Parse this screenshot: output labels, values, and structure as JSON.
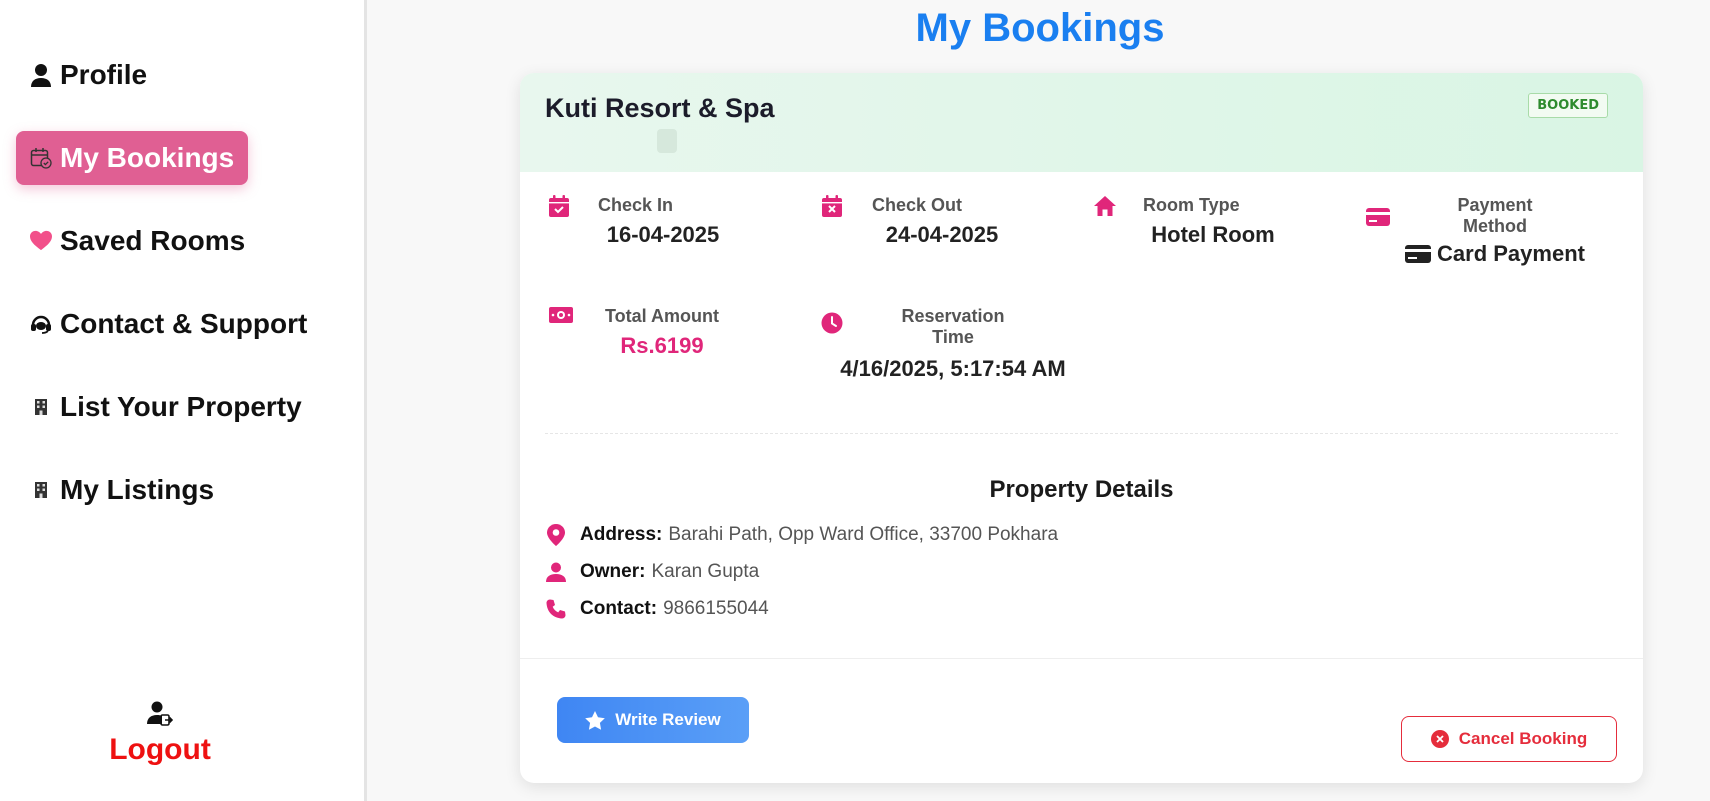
{
  "sidebar": {
    "items": [
      {
        "label": "Profile",
        "icon": "user-icon"
      },
      {
        "label": "My Bookings",
        "icon": "calendar-check-icon"
      },
      {
        "label": "Saved Rooms",
        "icon": "heart-icon"
      },
      {
        "label": "Contact & Support",
        "icon": "headset-icon"
      },
      {
        "label": "List Your Property",
        "icon": "building-icon"
      },
      {
        "label": "My Listings",
        "icon": "building-icon"
      }
    ],
    "logout_label": "Logout"
  },
  "page": {
    "title": "My Bookings"
  },
  "booking": {
    "hotel_name": "Kuti Resort & Spa",
    "status": "BOOKED",
    "check_in": {
      "label": "Check In",
      "value": "16-04-2025"
    },
    "check_out": {
      "label": "Check Out",
      "value": "24-04-2025"
    },
    "room_type": {
      "label": "Room Type",
      "value": "Hotel Room"
    },
    "payment": {
      "label_line1": "Payment",
      "label_line2": "Method",
      "value": "Card Payment"
    },
    "total": {
      "label": "Total Amount",
      "value": "Rs.6199"
    },
    "reservation": {
      "label_line1": "Reservation",
      "label_line2": "Time",
      "value": "4/16/2025, 5:17:54 AM"
    }
  },
  "property": {
    "title": "Property Details",
    "address_label": "Address:",
    "address": "Barahi Path, Opp Ward Office, 33700 Pokhara",
    "owner_label": "Owner:",
    "owner": "Karan Gupta",
    "contact_label": "Contact:",
    "contact": "9866155044"
  },
  "actions": {
    "review_label": "Write Review",
    "cancel_label": "Cancel Booking"
  },
  "colors": {
    "accent_pink": "#e0267a",
    "active_nav": "#e05f93",
    "title_blue": "#1a7ff0",
    "danger": "#e52d3c"
  }
}
